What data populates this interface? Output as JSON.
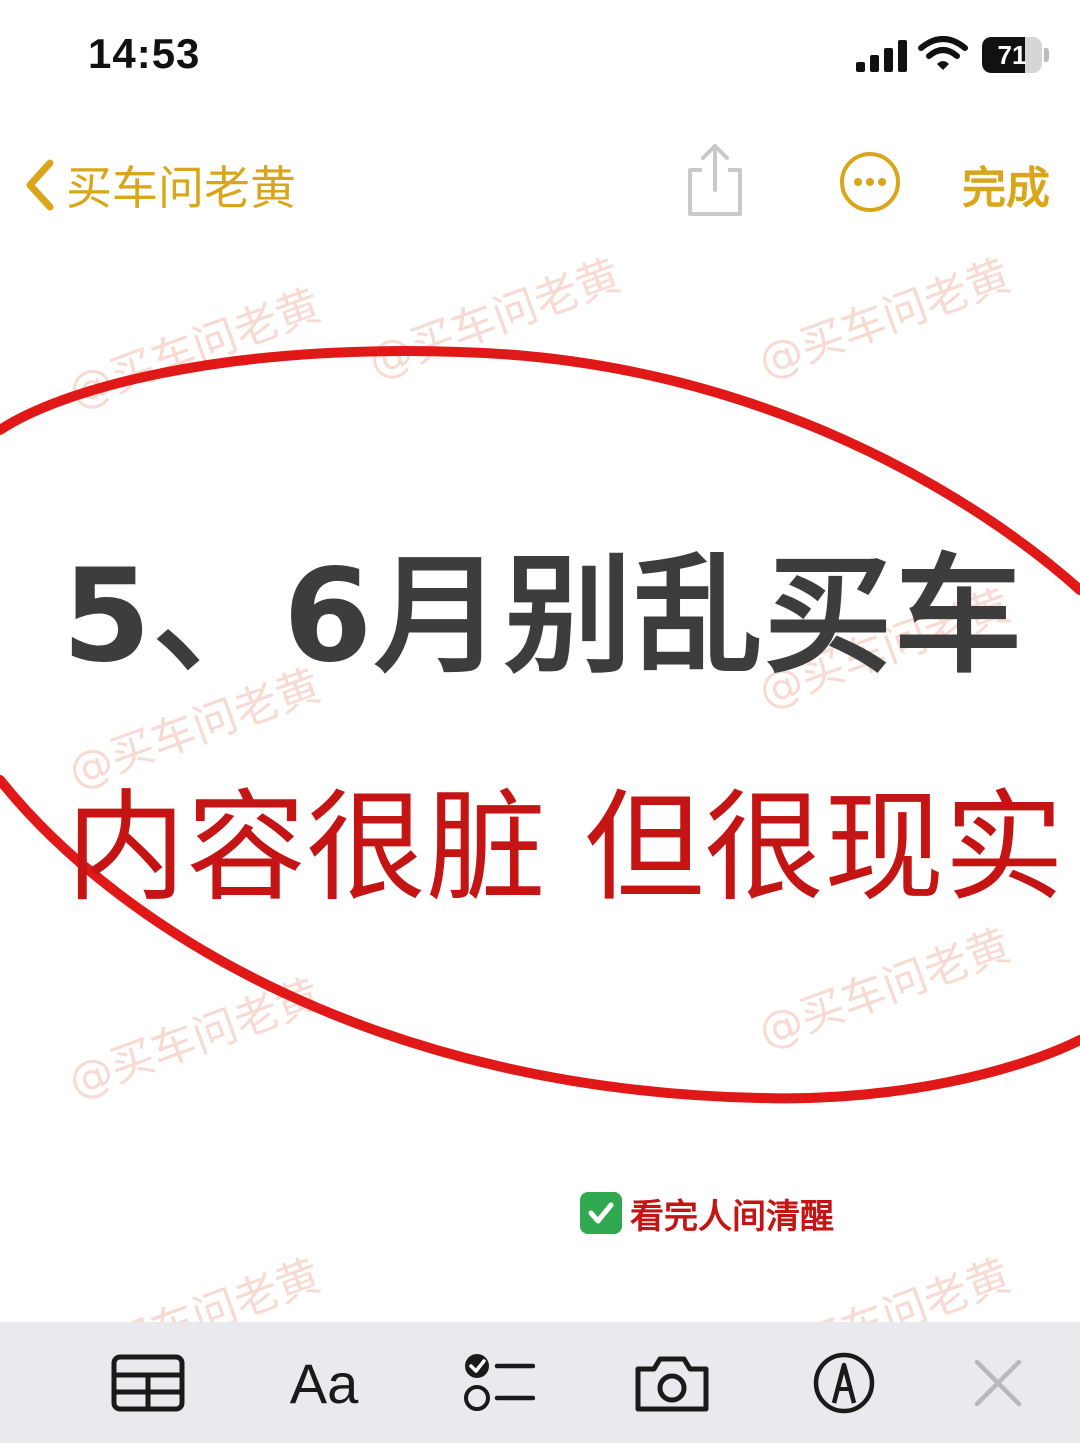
{
  "status_bar": {
    "time": "14:53",
    "battery_level": "71",
    "battery_fraction": 0.71,
    "icons": [
      "signal-icon",
      "wifi-icon",
      "battery-icon"
    ]
  },
  "nav": {
    "back_label": "买车问老黄",
    "done_label": "完成",
    "accent_color": "#d9a519",
    "icons": [
      "chevron-left-icon",
      "share-icon",
      "more-icon"
    ]
  },
  "note": {
    "headline": "5、6月别乱买车",
    "subheadline": "内容很脏 但很现实",
    "tag_text": "看完人间清醒",
    "headline_color": "#3d3d3d",
    "subheadline_color": "#c41414"
  },
  "watermark": {
    "text": "@买车问老黄"
  },
  "toolbar": {
    "format_label": "Aa",
    "icons": [
      "table-icon",
      "text-format-icon",
      "checklist-icon",
      "camera-icon",
      "markup-icon",
      "close-icon"
    ]
  }
}
